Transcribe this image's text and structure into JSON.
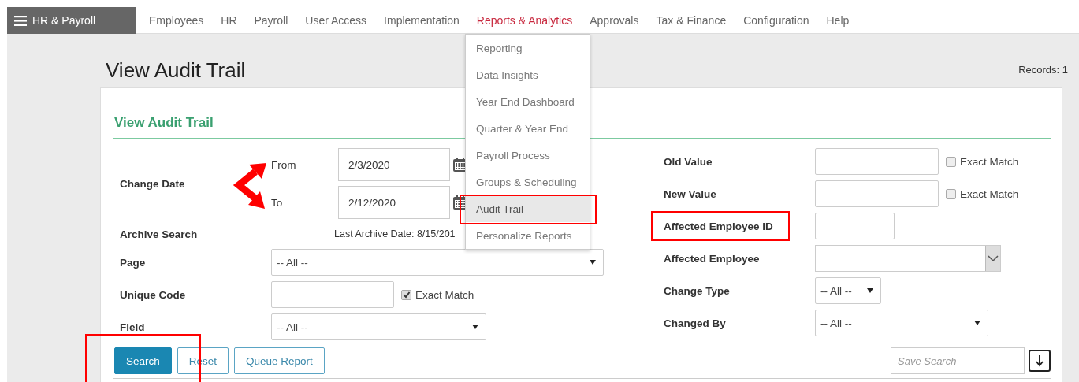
{
  "app": {
    "brand": "HR & Payroll"
  },
  "nav": [
    {
      "label": "Employees",
      "selected": false
    },
    {
      "label": "HR",
      "selected": false
    },
    {
      "label": "Payroll",
      "selected": false
    },
    {
      "label": "User Access",
      "selected": false
    },
    {
      "label": "Implementation",
      "selected": false
    },
    {
      "label": "Reports & Analytics",
      "selected": true
    },
    {
      "label": "Approvals",
      "selected": false
    },
    {
      "label": "Tax & Finance",
      "selected": false
    },
    {
      "label": "Configuration",
      "selected": false
    },
    {
      "label": "Help",
      "selected": false
    }
  ],
  "nav_menu": {
    "items": [
      {
        "label": "Reporting",
        "selected": false,
        "highlighted": false
      },
      {
        "label": "Data Insights",
        "selected": false,
        "highlighted": false
      },
      {
        "label": "Year End Dashboard",
        "selected": false,
        "highlighted": false
      },
      {
        "label": "Quarter & Year End",
        "selected": false,
        "highlighted": false
      },
      {
        "label": "Payroll Process",
        "selected": false,
        "highlighted": false
      },
      {
        "label": "Groups & Scheduling",
        "selected": false,
        "highlighted": false
      },
      {
        "label": "Audit Trail",
        "selected": true,
        "highlighted": true
      },
      {
        "label": "Personalize Reports",
        "selected": false,
        "highlighted": false
      }
    ]
  },
  "page": {
    "title": "View Audit Trail",
    "records": "Records: 1"
  },
  "section_title": "View Audit Trail",
  "left_fields": [
    {
      "kind": "date_range",
      "label": "Change Date",
      "highlighted": false,
      "arrow": true,
      "ranges": [
        {
          "label": "From",
          "value": "2/3/2020"
        },
        {
          "label": "To",
          "value": "2/12/2020"
        }
      ]
    },
    {
      "kind": "info",
      "label": "Archive Search",
      "highlighted": false,
      "text": "Last Archive Date: 8/15/201"
    },
    {
      "kind": "select",
      "label": "Page",
      "highlighted": false,
      "value": "-- All --"
    },
    {
      "kind": "text_match",
      "label": "Unique Code",
      "highlighted": false,
      "match": {
        "label": "Exact Match",
        "checked": true
      }
    },
    {
      "kind": "select",
      "label": "Field",
      "highlighted": false,
      "value": "-- All --"
    }
  ],
  "right_fields": [
    {
      "kind": "text_match",
      "label": "Old Value",
      "highlighted": false,
      "match": {
        "label": "Exact Match",
        "checked": false
      }
    },
    {
      "kind": "text_match",
      "label": "New Value",
      "highlighted": false,
      "match": {
        "label": "Exact Match",
        "checked": false
      }
    },
    {
      "kind": "text",
      "label": "Affected Employee ID",
      "highlighted": true
    },
    {
      "kind": "combo",
      "label": "Affected Employee",
      "highlighted": false
    },
    {
      "kind": "select",
      "label": "Change Type",
      "highlighted": false,
      "value": "-- All --"
    },
    {
      "kind": "select",
      "label": "Changed By",
      "highlighted": false,
      "value": "-- All --"
    }
  ],
  "buttons": [
    {
      "label": "Search",
      "kind": "primary",
      "highlighted": true
    },
    {
      "label": "Reset",
      "kind": "outline",
      "highlighted": false
    },
    {
      "label": "Queue Report",
      "kind": "outline",
      "highlighted": false
    }
  ],
  "save_search": {
    "placeholder": "Save Search"
  }
}
